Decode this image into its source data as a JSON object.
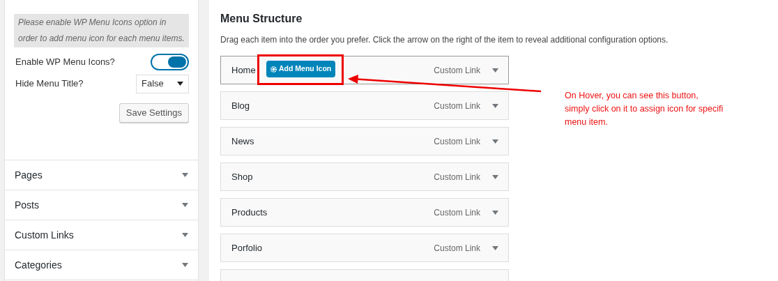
{
  "sidebar": {
    "notice": "Please enable WP Menu Icons option in order to add menu icon for each menu items.",
    "settings": [
      {
        "kind": "toggle",
        "label": "Enable WP Menu Icons?",
        "on": true
      },
      {
        "kind": "select",
        "label": "Hide Menu Title?",
        "value": "False"
      }
    ],
    "save_button": "Save Settings",
    "sections": [
      {
        "label": "Pages",
        "expanded": false
      },
      {
        "label": "Posts",
        "expanded": false
      },
      {
        "label": "Custom Links",
        "expanded": false
      },
      {
        "label": "Categories",
        "expanded": false
      }
    ]
  },
  "menu_structure": {
    "title": "Menu Structure",
    "description": "Drag each item into the order you prefer. Click the arrow on the right of the item to reveal additional configuration options.",
    "items": [
      {
        "label": "Home",
        "type": "Custom Link",
        "hovered": true,
        "button": "Add Menu Icon"
      },
      {
        "label": "Blog",
        "type": "Custom Link",
        "hovered": false
      },
      {
        "label": "News",
        "type": "Custom Link",
        "hovered": false
      },
      {
        "label": "Shop",
        "type": "Custom Link",
        "hovered": false
      },
      {
        "label": "Products",
        "type": "Custom Link",
        "hovered": false
      },
      {
        "label": "Porfolio",
        "type": "Custom Link",
        "hovered": false
      }
    ]
  },
  "annotation": {
    "lines": [
      "On Hover, you can see this button,",
      "simply click on it to assign icon for specifi",
      "menu item."
    ]
  }
}
